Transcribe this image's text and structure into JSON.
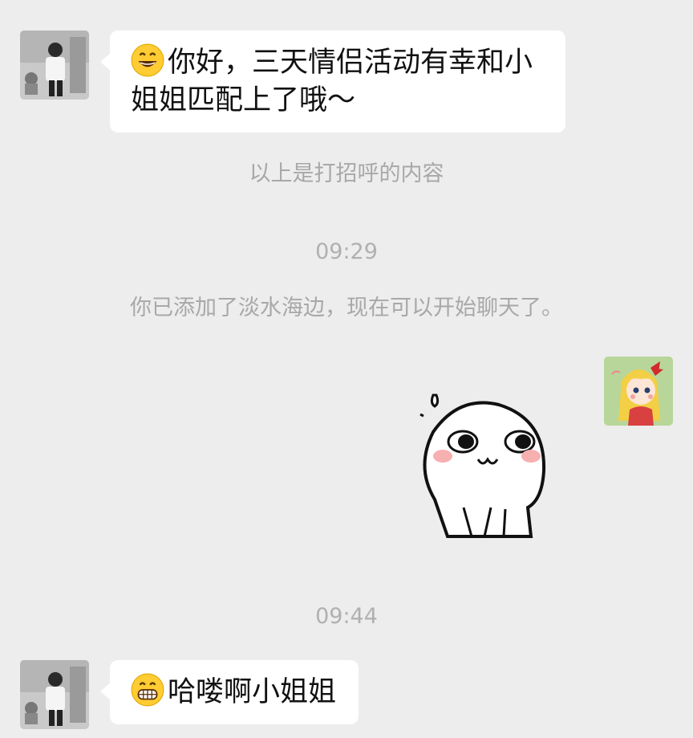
{
  "messages": [
    {
      "id": "m1",
      "side": "left",
      "emoji": "grinning-face-icon",
      "text": "你好，三天情侣活动有幸和小姐姐匹配上了哦～"
    },
    {
      "id": "m2",
      "side": "right",
      "type": "sticker",
      "sticker": "cute-white-blob-sticker"
    },
    {
      "id": "m3",
      "side": "left",
      "emoji": "grinning-teeth-face-icon",
      "text": "哈喽啊小姐姐"
    }
  ],
  "system": {
    "greeting_note": "以上是打招呼的内容",
    "time1": "09:29",
    "added_note": "你已添加了淡水海边，现在可以开始聊天了。",
    "time2": "09:44"
  },
  "colors": {
    "background": "#ededed",
    "bubble": "#ffffff",
    "system_text": "#a8a8a8"
  }
}
